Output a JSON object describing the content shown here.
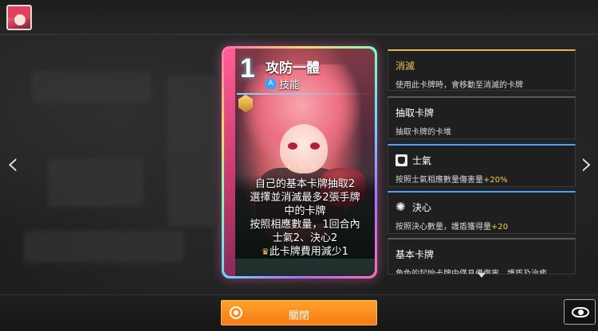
{
  "card": {
    "cost": "1",
    "title": "攻防一體",
    "type_label": "技能",
    "divider": "✦ ✦ ✦",
    "description_lines": [
      "自己的基本卡牌抽取2",
      "選擇並消滅最多2張手牌",
      "中的卡牌",
      "按照相應數量，1回合內",
      "士氣2、決心2",
      "此卡牌費用減少1"
    ],
    "cost_coin": "♛"
  },
  "keywords": [
    {
      "title": "消滅",
      "desc": "使用此卡牌時，會移動至消滅的卡牌",
      "icon": ""
    },
    {
      "title": "抽取卡牌",
      "desc": "抽取卡牌的卡堆",
      "icon": ""
    },
    {
      "title": "士氣",
      "desc_pre": "按照士氣相應數量傷害量",
      "desc_hl": "+20%",
      "icon": "fist-icon"
    },
    {
      "title": "決心",
      "desc_pre": "按照決心數量，護盾獲得量",
      "desc_hl": "+20",
      "icon": "resolve-icon"
    },
    {
      "title": "基本卡牌",
      "desc": "角色的起始卡牌中僅具備傷害、護盾及治癒",
      "icon": ""
    }
  ],
  "nav": {
    "prev": "‹",
    "next": "›"
  },
  "bottom": {
    "close_label": "關閉"
  },
  "colors": {
    "accent_orange": "#f57c14",
    "keyword_gold": "#f1c35d",
    "highlight": "#f6c94f",
    "skill_blue": "#3aa0ff"
  }
}
